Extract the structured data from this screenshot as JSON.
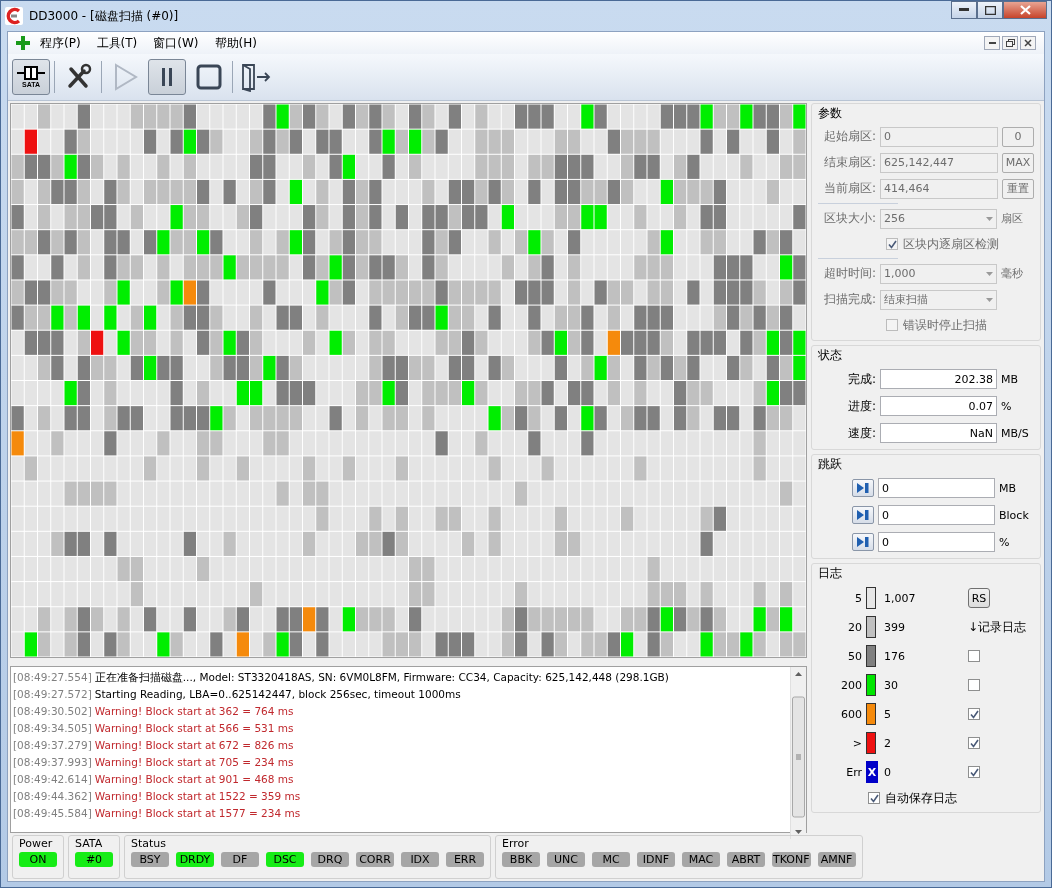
{
  "window": {
    "title": "DD3000 - [磁盘扫描 (#0)]"
  },
  "menu": {
    "items": [
      "程序(P)",
      "工具(T)",
      "窗口(W)",
      "帮助(H)"
    ]
  },
  "toolbar": {
    "items": [
      {
        "kind": "sata",
        "label": "SATA",
        "pressed": true,
        "disabled": false
      },
      {
        "kind": "separator"
      },
      {
        "kind": "tools",
        "pressed": false,
        "disabled": false
      },
      {
        "kind": "separator"
      },
      {
        "kind": "play",
        "pressed": false,
        "disabled": true
      },
      {
        "kind": "pause",
        "pressed": true,
        "disabled": false
      },
      {
        "kind": "stop",
        "pressed": false,
        "disabled": false
      },
      {
        "kind": "separator"
      },
      {
        "kind": "exit",
        "pressed": false,
        "disabled": false
      }
    ]
  },
  "log": {
    "lines": [
      {
        "kind": "info",
        "time": "[08:49:27.554]",
        "text": "正在准备扫描磁盘..., Model: ST3320418AS, SN: 6VM0L8FM, Firmware: CC34, Capacity: 625,142,448 (298.1GB)"
      },
      {
        "kind": "info",
        "time": "[08:49:27.572]",
        "text": "Starting Reading, LBA=0..625142447, block 256sec, timeout 1000ms"
      },
      {
        "kind": "warning",
        "time": "[08:49:30.502]",
        "text": "Warning! Block start at 362 = 764 ms"
      },
      {
        "kind": "warning",
        "time": "[08:49:34.505]",
        "text": "Warning! Block start at 566 = 531 ms"
      },
      {
        "kind": "warning",
        "time": "[08:49:37.279]",
        "text": "Warning! Block start at 672 = 826 ms"
      },
      {
        "kind": "warning",
        "time": "[08:49:37.993]",
        "text": "Warning! Block start at 705 = 234 ms"
      },
      {
        "kind": "warning",
        "time": "[08:49:42.614]",
        "text": "Warning! Block start at 901 = 468 ms"
      },
      {
        "kind": "warning",
        "time": "[08:49:44.362]",
        "text": "Warning! Block start at 1522 = 359 ms"
      },
      {
        "kind": "warning",
        "time": "[08:49:45.584]",
        "text": "Warning! Block start at 1577 = 234 ms"
      }
    ]
  },
  "params": {
    "title": "参数",
    "disabled": true,
    "rows": [
      {
        "kind": "field",
        "label": "起始扇区:",
        "value": "0",
        "button": "0"
      },
      {
        "kind": "field",
        "label": "结束扇区:",
        "value": "625,142,447",
        "button": "MAX"
      },
      {
        "kind": "field",
        "label": "当前扇区:",
        "value": "414,464",
        "button": "重置"
      },
      {
        "kind": "separator"
      },
      {
        "kind": "select",
        "label": "区块大小:",
        "value": "256",
        "unit": "扇区"
      },
      {
        "kind": "checkbox",
        "label": "区块内逐扇区检测",
        "checked": true
      },
      {
        "kind": "separator"
      },
      {
        "kind": "select",
        "label": "超时时间:",
        "value": "1,000",
        "unit": "毫秒"
      },
      {
        "kind": "select",
        "label": "扫描完成:",
        "value": "结束扫描"
      },
      {
        "kind": "checkbox",
        "label": "错误时停止扫描",
        "checked": false
      }
    ]
  },
  "status": {
    "title": "状态",
    "rows": [
      {
        "label": "完成:",
        "value": "202.38",
        "unit": "MB"
      },
      {
        "label": "进度:",
        "value": "0.07",
        "unit": "%"
      },
      {
        "label": "速度:",
        "value": "NaN",
        "unit": "MB/S"
      }
    ]
  },
  "jump": {
    "title": "跳跃",
    "rows": [
      {
        "value": "0",
        "unit": "MB"
      },
      {
        "value": "0",
        "unit": "Block"
      },
      {
        "value": "0",
        "unit": "%"
      }
    ]
  },
  "log_legend": {
    "title": "日志",
    "rs_button": "RS",
    "log_header": "↓记录日志",
    "items": [
      {
        "kind": "level",
        "label": "5",
        "color": "#e6e6e6",
        "count": "1,007"
      },
      {
        "kind": "level",
        "label": "20",
        "color": "#c0c0c0",
        "count": "399"
      },
      {
        "kind": "level",
        "label": "50",
        "color": "#808080",
        "count": "176",
        "checked": false
      },
      {
        "kind": "level",
        "label": "200",
        "color": "#00e600",
        "count": "30",
        "checked": false
      },
      {
        "kind": "level",
        "label": "600",
        "color": "#f58a0c",
        "count": "5",
        "checked": true
      },
      {
        "kind": "level",
        "label": ">",
        "color": "#ee1111",
        "count": "2",
        "checked": true
      },
      {
        "kind": "error",
        "label": "Err",
        "color": "#0000c8",
        "mark": "X",
        "count": "0",
        "checked": true
      }
    ],
    "autosave": {
      "label": "自动保存日志",
      "checked": true
    }
  },
  "status_bar": {
    "groups": [
      {
        "title": "Power",
        "items": [
          {
            "label": "ON",
            "on": true
          }
        ]
      },
      {
        "title": "SATA",
        "items": [
          {
            "label": "#0",
            "on": true
          }
        ]
      },
      {
        "title": "Status",
        "items": [
          {
            "label": "BSY",
            "on": false
          },
          {
            "label": "DRDY",
            "on": true
          },
          {
            "label": "DF",
            "on": false
          },
          {
            "label": "DSC",
            "on": true
          },
          {
            "label": "DRQ",
            "on": false
          },
          {
            "label": "CORR",
            "on": false
          },
          {
            "label": "IDX",
            "on": false
          },
          {
            "label": "ERR",
            "on": false
          }
        ]
      },
      {
        "title": "Error",
        "items": [
          {
            "label": "BBK",
            "on": false
          },
          {
            "label": "UNC",
            "on": false
          },
          {
            "label": "MC",
            "on": false
          },
          {
            "label": "IDNF",
            "on": false
          },
          {
            "label": "MAC",
            "on": false
          },
          {
            "label": "ABRT",
            "on": false
          },
          {
            "label": "TKONF",
            "on": false
          },
          {
            "label": "AMNF",
            "on": false
          }
        ]
      }
    ]
  }
}
